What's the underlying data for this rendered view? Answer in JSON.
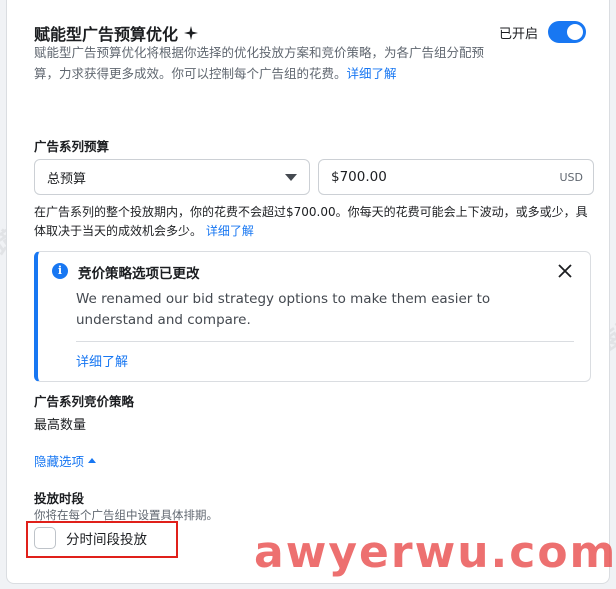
{
  "header": {
    "title": "赋能型广告预算优化",
    "toggle_label": "已开启",
    "description": "赋能型广告预算优化将根据你选择的优化投放方案和竞价策略，为各广告组分配预算，力求获得更多成效。你可以控制每个广告组的花费。",
    "learn_more": "详细了解"
  },
  "budget": {
    "label": "广告系列预算",
    "type_value": "总预算",
    "amount_value": "$700.00",
    "currency": "USD",
    "note": "在广告系列的整个投放期内，你的花费不会超过$700.00。你每天的花费可能会上下波动，或多或少，具体取决于当天的成效机会多少。",
    "note_link": "详细了解"
  },
  "notice": {
    "title": "竞价策略选项已更改",
    "body": "We renamed our bid strategy options to make them easier to understand and compare.",
    "link": "详细了解"
  },
  "bid_strategy": {
    "label": "广告系列竞价策略",
    "value": "最高数量",
    "hide_options": "隐藏选项"
  },
  "schedule": {
    "label": "投放时段",
    "note": "你将在每个广告组中设置具体排期。",
    "checkbox_label": "分时间段投放"
  },
  "watermarks": {
    "text": "跨境出海陆跑",
    "brand": "awyerwu.com"
  },
  "colors": {
    "accent": "#1877f2",
    "highlight": "#e0201a"
  }
}
